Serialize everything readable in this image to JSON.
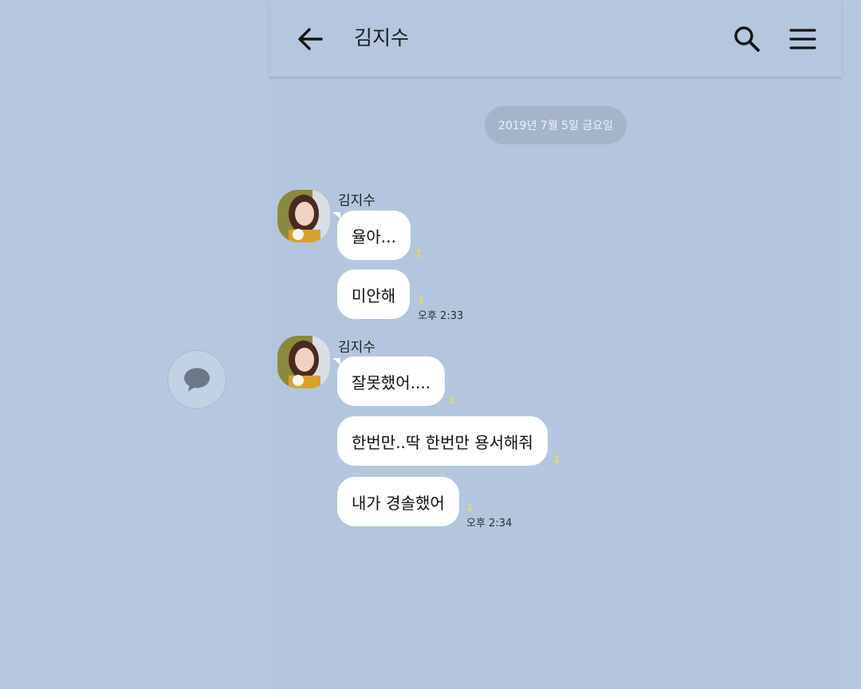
{
  "header": {
    "title": "김지수",
    "back_icon": "arrow-left-icon",
    "search_icon": "search-icon",
    "menu_icon": "hamburger-menu-icon"
  },
  "date_divider": "2019년 7월 5일 금요일",
  "groups": [
    {
      "sender": "김지수",
      "messages": [
        {
          "text": "율아...",
          "unread": "1"
        },
        {
          "text": "미안해",
          "unread": "1",
          "time": "오후 2:33"
        }
      ]
    },
    {
      "sender": "김지수",
      "messages": [
        {
          "text": "잘못했어....",
          "unread": "1"
        },
        {
          "text": "한번만..딱 한번만 용서해줘",
          "unread": "1"
        },
        {
          "text": "내가 경솔했어",
          "unread": "1",
          "time": "오후 2:34"
        }
      ]
    }
  ],
  "floating_button_icon": "chat-bubble-icon",
  "colors": {
    "background": "#b6c8df",
    "bubble": "#ffffff",
    "unread": "#e8d95a",
    "date_pill": "#a5b5c9"
  }
}
